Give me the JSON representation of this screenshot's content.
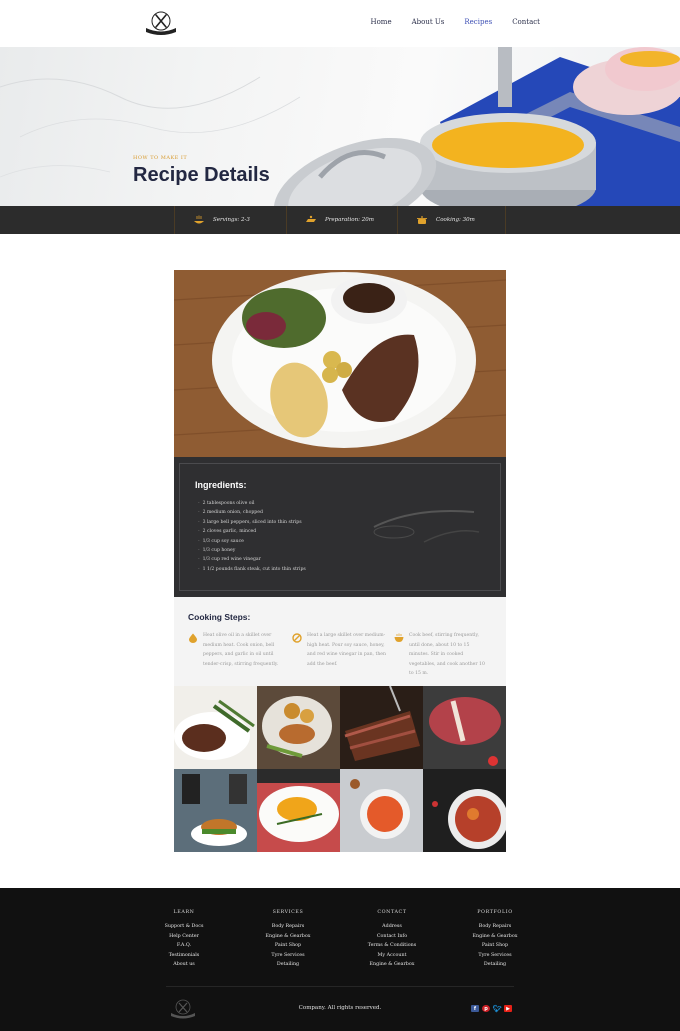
{
  "nav": {
    "items": [
      {
        "label": "Home",
        "active": false
      },
      {
        "label": "About Us",
        "active": false
      },
      {
        "label": "Recipes",
        "active": true
      },
      {
        "label": "Contact",
        "active": false
      }
    ]
  },
  "hero": {
    "kicker": "HOW TO MAKE IT",
    "title": "Recipe Details"
  },
  "info": {
    "servings": "Servings: 2-3",
    "preparation": "Preparation: 20m",
    "cooking": "Cooking: 30m"
  },
  "ingredients": {
    "title": "Ingredients:",
    "items": [
      "2 tablespoons olive oil",
      "2 medium onion, chopped",
      "3 large bell peppers, sliced into thin strips",
      "2 cloves garlic, minced",
      "1/3 cup soy sauce",
      "1/3 cup honey",
      "1/3 cup red wine vinegar",
      "1 1/2 pounds flank steak, cut into thin strips"
    ]
  },
  "steps": {
    "title": "Cooking Steps:",
    "items": [
      {
        "icon": "drop-icon",
        "text": "Heat olive oil in a skillet over medium heat. Cook onion, bell peppers, and garlic in oil until tender-crisp, stirring frequently."
      },
      {
        "icon": "pan-icon",
        "text": "Heat a large skillet over medium-high heat. Pour soy sauce, honey, and red wine vinegar in pan, then add the beef."
      },
      {
        "icon": "bowl-icon",
        "text": "Cook beef, stirring frequently, until done, about 10 to 15 minutes. Stir in cooked vegetables, and cook another 10 to 15 m."
      }
    ]
  },
  "footer": {
    "columns": [
      {
        "title": "LEARN",
        "links": [
          "Support & Docs",
          "Help Center",
          "F.A.Q.",
          "Testimonials",
          "About us"
        ]
      },
      {
        "title": "SERVICES",
        "links": [
          "Body Repairs",
          "Engine & Gearbox",
          "Paint Shop",
          "Tyre Services",
          "Detailing"
        ]
      },
      {
        "title": "CONTACT",
        "links": [
          "Address",
          "Contact Info",
          "Terms & Conditions",
          "My Account",
          "Engine & Gearbox"
        ]
      },
      {
        "title": "PORTFOLIO",
        "links": [
          "Body Repairs",
          "Engine & Gearbox",
          "Paint Shop",
          "Tyre Services",
          "Detailing"
        ]
      }
    ],
    "copyright": "Company. All rights reserved."
  },
  "colors": {
    "accent": "#d89b2f",
    "heading": "#232842",
    "nav_active": "#3f51b5",
    "facebook": "#3b5998",
    "pinterest": "#cb2027",
    "twitter": "#1da1f2",
    "youtube": "#e62117"
  }
}
